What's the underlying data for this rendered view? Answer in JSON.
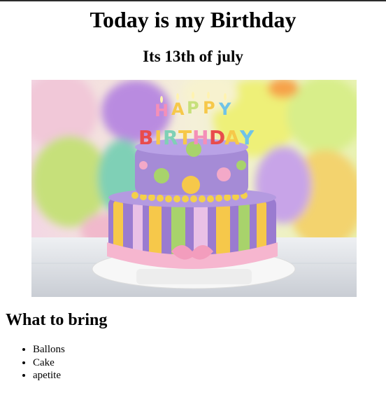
{
  "page": {
    "title": "Today is my Birthday",
    "subtitle": "Its 13th of july"
  },
  "photo": {
    "subject": "birthday-cake",
    "candle_letters": [
      "H",
      "A",
      "P",
      "P",
      "Y",
      "B",
      "I",
      "R",
      "T",
      "H",
      "D",
      "A",
      "Y"
    ]
  },
  "bring": {
    "heading": "What to bring",
    "items": [
      "Ballons",
      "Cake",
      "apetite"
    ]
  },
  "colors": {
    "cake_top": "#a58bd6",
    "cake_bottom": "#9a7bd0",
    "stripe_yellow": "#f6c84a",
    "stripe_green": "#a8d36b",
    "ribbon_pink": "#f6b6cf"
  }
}
